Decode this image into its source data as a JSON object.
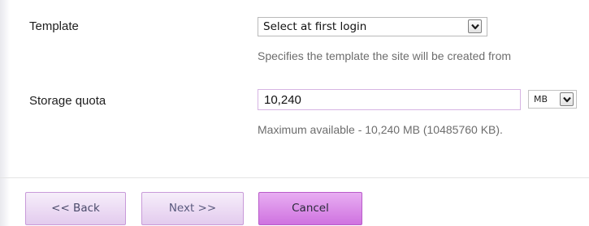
{
  "template": {
    "label": "Template",
    "selected": "Select at first login",
    "help": "Specifies the template the site will be created from"
  },
  "quota": {
    "label": "Storage quota",
    "value": "10,240",
    "unit": "MB",
    "help": "Maximum available - 10,240 MB (10485760 KB)."
  },
  "buttons": {
    "back": "<< Back",
    "next": "Next >>",
    "cancel": "Cancel"
  },
  "colors": {
    "button_border": "#c89ad9",
    "cancel_accent": "#cf72e0",
    "input_focus_border": "#d6b4e3"
  },
  "icons": {
    "dropdown": "chevron-down-icon"
  }
}
